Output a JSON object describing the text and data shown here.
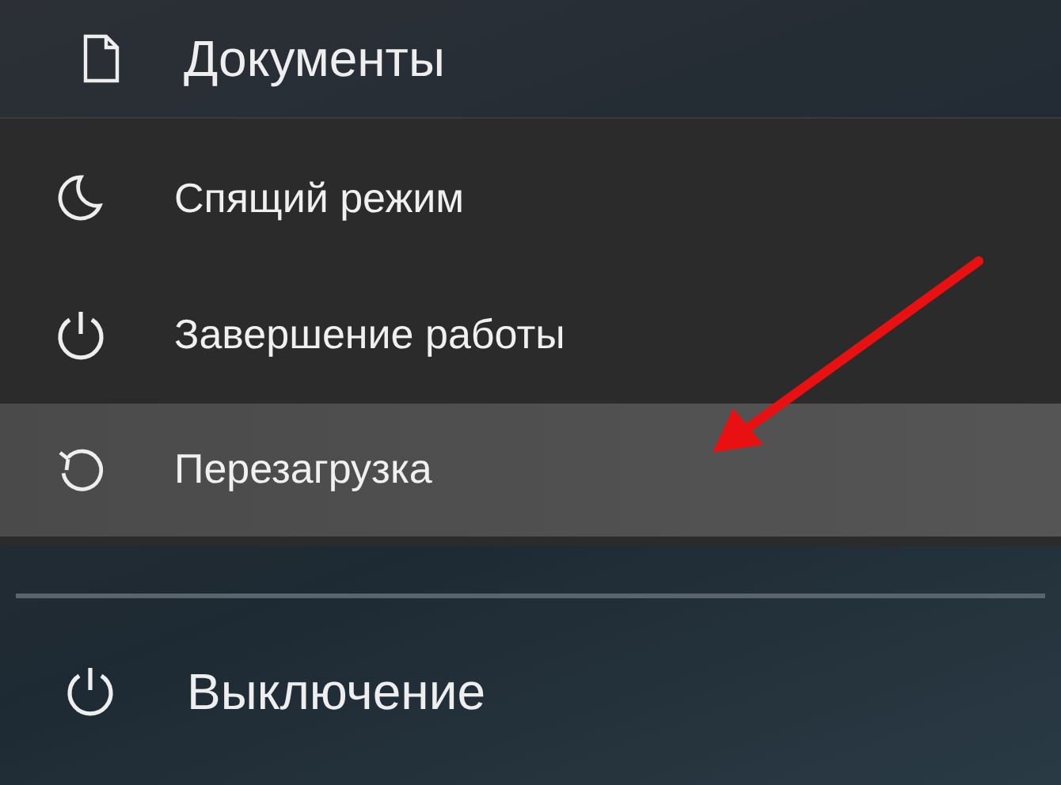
{
  "start_menu": {
    "top_item": {
      "label": "Документы"
    },
    "power_menu": {
      "items": [
        {
          "kind": "sleep",
          "label": "Спящий режим",
          "selected": false
        },
        {
          "kind": "shutdown",
          "label": "Завершение работы",
          "selected": false
        },
        {
          "kind": "restart",
          "label": "Перезагрузка",
          "selected": true
        }
      ]
    },
    "bottom_item": {
      "label": "Выключение"
    }
  }
}
